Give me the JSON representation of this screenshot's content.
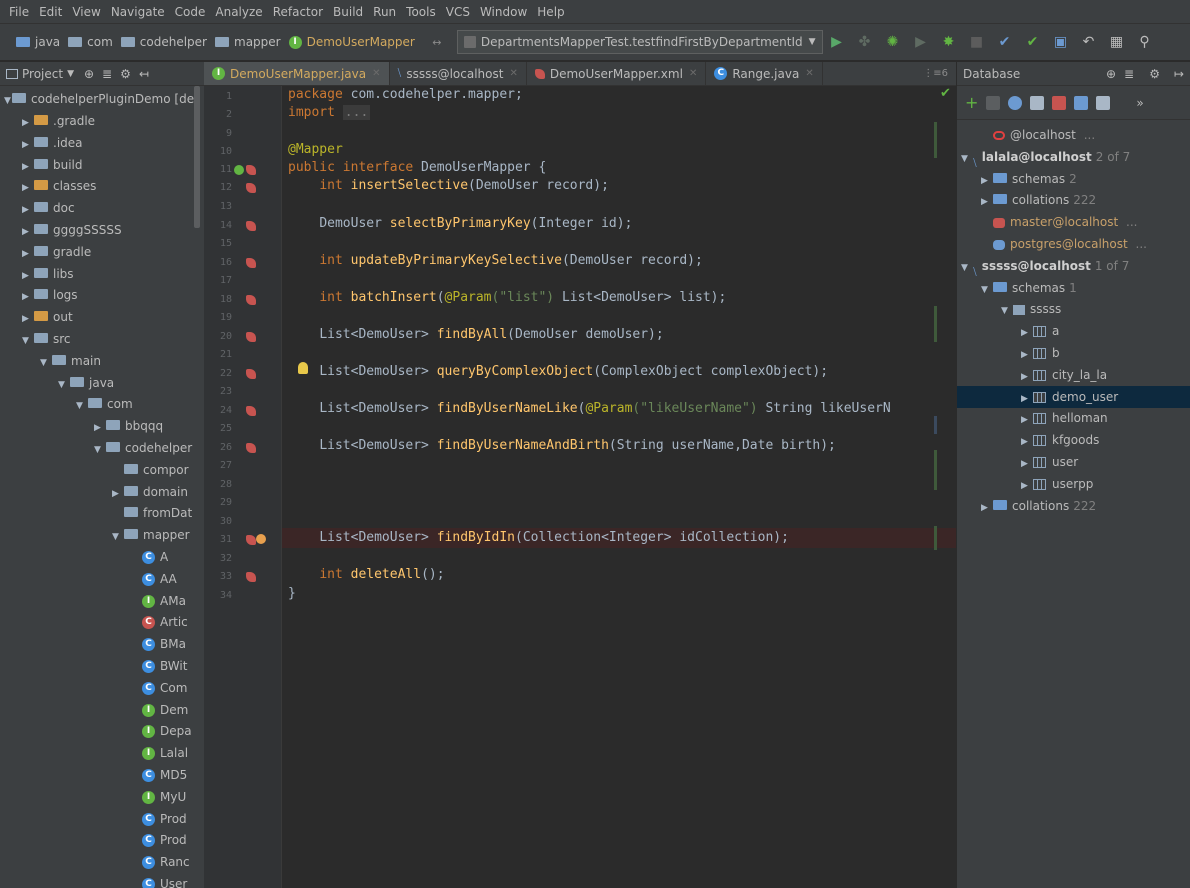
{
  "menu": [
    "File",
    "Edit",
    "View",
    "Navigate",
    "Code",
    "Analyze",
    "Refactor",
    "Build",
    "Run",
    "Tools",
    "VCS",
    "Window",
    "Help"
  ],
  "breadcrumbs": [
    "java",
    "com",
    "codehelper",
    "mapper",
    "DemoUserMapper"
  ],
  "run_config": "DepartmentsMapperTest.testfindFirstByDepartmentId",
  "project_panel": {
    "title": "Project",
    "root": "codehelperPluginDemo [der",
    "items": [
      {
        "label": ".gradle",
        "indent": 1
      },
      {
        "label": ".idea",
        "indent": 1
      },
      {
        "label": "build",
        "indent": 1
      },
      {
        "label": "classes",
        "indent": 1
      },
      {
        "label": "doc",
        "indent": 1
      },
      {
        "label": "ggggSSSSS",
        "indent": 1
      },
      {
        "label": "gradle",
        "indent": 1
      },
      {
        "label": "libs",
        "indent": 1
      },
      {
        "label": "logs",
        "indent": 1
      },
      {
        "label": "out",
        "indent": 1
      },
      {
        "label": "src",
        "indent": 1
      },
      {
        "label": "main",
        "indent": 2
      },
      {
        "label": "java",
        "indent": 3
      },
      {
        "label": "com",
        "indent": 4
      },
      {
        "label": "bbqqq",
        "indent": 5
      },
      {
        "label": "codehelper",
        "indent": 5
      },
      {
        "label": "compor",
        "indent": 6
      },
      {
        "label": "domain",
        "indent": 6
      },
      {
        "label": "fromDat",
        "indent": 6
      },
      {
        "label": "mapper",
        "indent": 6
      },
      {
        "label": "A",
        "indent": 7
      },
      {
        "label": "AA",
        "indent": 7
      },
      {
        "label": "AMa",
        "indent": 7
      },
      {
        "label": "Artic",
        "indent": 7
      },
      {
        "label": "BMa",
        "indent": 7
      },
      {
        "label": "BWit",
        "indent": 7
      },
      {
        "label": "Com",
        "indent": 7
      },
      {
        "label": "Dem",
        "indent": 7
      },
      {
        "label": "Depa",
        "indent": 7
      },
      {
        "label": "Lalal",
        "indent": 7
      },
      {
        "label": "MD5",
        "indent": 7
      },
      {
        "label": "MyU",
        "indent": 7
      },
      {
        "label": "Prod",
        "indent": 7
      },
      {
        "label": "Prod",
        "indent": 7
      },
      {
        "label": "Ranc",
        "indent": 7
      },
      {
        "label": "User",
        "indent": 7
      }
    ]
  },
  "tabs": [
    {
      "label": "DemoUserMapper.java",
      "active": true
    },
    {
      "label": "sssss@localhost",
      "active": false
    },
    {
      "label": "DemoUserMapper.xml",
      "active": false
    },
    {
      "label": "Range.java",
      "active": false
    }
  ],
  "tab_overflow": "⋮≡6",
  "line_numbers": [
    "1",
    "2",
    "9",
    "10",
    "11",
    "12",
    "13",
    "14",
    "15",
    "16",
    "17",
    "18",
    "19",
    "20",
    "21",
    "22",
    "23",
    "24",
    "25",
    "26",
    "27",
    "28",
    "29",
    "30",
    "31",
    "32",
    "33",
    "34"
  ],
  "code": {
    "package_kw": "package",
    "package_name": " com.codehelper.mapper;",
    "import_kw": "import",
    "import_fold": "...",
    "annotation": "@Mapper",
    "iface_kw": "public interface",
    "iface_name": " DemoUserMapper {",
    "insertSelective_t": "int ",
    "insertSelective_m": "insertSelective",
    "insertSelective_a": "(DemoUser record);",
    "selectByPrimaryKey_t": "DemoUser ",
    "selectByPrimaryKey_m": "selectByPrimaryKey",
    "selectByPrimaryKey_a": "(Integer id);",
    "updateByPrimaryKeySelective_t": "int ",
    "updateByPrimaryKeySelective_m": "updateByPrimaryKeySelective",
    "updateByPrimaryKeySelective_a": "(DemoUser record);",
    "batchInsert_t": "int ",
    "batchInsert_m": "batchInsert",
    "batchInsert_p": "(",
    "batchInsert_an": "@Param",
    "batchInsert_s": "(\"list\")",
    "batchInsert_a": " List<DemoUser> list);",
    "findByAll_t": "List<DemoUser> ",
    "findByAll_m": "findByAll",
    "findByAll_a": "(DemoUser demoUser);",
    "queryByComplexObject_t": "List<DemoUser> ",
    "queryByComplexObject_m": "queryByComplexObject",
    "queryByComplexObject_a": "(ComplexObject complexObject);",
    "findByUserNameLike_t": "List<DemoUser> ",
    "findByUserNameLike_m": "findByUserNameLike",
    "findByUserNameLike_p": "(",
    "findByUserNameLike_an": "@Param",
    "findByUserNameLike_s": "(\"likeUserName\")",
    "findByUserNameLike_a": " String likeUserN",
    "findByUserNameAndBirth_t": "List<DemoUser> ",
    "findByUserNameAndBirth_m": "findByUserNameAndBirth",
    "findByUserNameAndBirth_a": "(String userName,Date birth);",
    "findByIdIn_t": "List<DemoUser> ",
    "findByIdIn_m": "findByIdIn",
    "findByIdIn_a": "(Collection<Integer> idCollection);",
    "deleteAll_t": "int ",
    "deleteAll_m": "deleteAll",
    "deleteAll_a": "();",
    "close": "}"
  },
  "database": {
    "title": "Database",
    "items": [
      {
        "label": "@localhost",
        "extra": " ...",
        "indent": 1,
        "arrow": "",
        "icon": "oracle"
      },
      {
        "label": "lalala@localhost",
        "extra": "2 of 7",
        "indent": 0,
        "arrow": "▼",
        "icon": "ds",
        "bold": true
      },
      {
        "label": "schemas",
        "extra": "2",
        "indent": 1,
        "arrow": "▶",
        "icon": "folder"
      },
      {
        "label": "collations",
        "extra": "222",
        "indent": 1,
        "arrow": "▶",
        "icon": "folder"
      },
      {
        "label": "master@localhost",
        "extra": " ...",
        "indent": 1,
        "arrow": "",
        "icon": "mssql"
      },
      {
        "label": "postgres@localhost",
        "extra": " ...",
        "indent": 1,
        "arrow": "",
        "icon": "pg"
      },
      {
        "label": "sssss@localhost",
        "extra": "1 of 7",
        "indent": 0,
        "arrow": "▼",
        "icon": "ds",
        "bold": true
      },
      {
        "label": "schemas",
        "extra": "1",
        "indent": 1,
        "arrow": "▼",
        "icon": "folder"
      },
      {
        "label": "sssss",
        "extra": "",
        "indent": 2,
        "arrow": "▼",
        "icon": "schema"
      },
      {
        "label": "a",
        "extra": "",
        "indent": 3,
        "arrow": "▶",
        "icon": "table"
      },
      {
        "label": "b",
        "extra": "",
        "indent": 3,
        "arrow": "▶",
        "icon": "table"
      },
      {
        "label": "city_la_la",
        "extra": "",
        "indent": 3,
        "arrow": "▶",
        "icon": "table"
      },
      {
        "label": "demo_user",
        "extra": "",
        "indent": 3,
        "arrow": "▶",
        "icon": "table",
        "selected": true
      },
      {
        "label": "helloman",
        "extra": "",
        "indent": 3,
        "arrow": "▶",
        "icon": "table"
      },
      {
        "label": "kfgoods",
        "extra": "",
        "indent": 3,
        "arrow": "▶",
        "icon": "table"
      },
      {
        "label": "user",
        "extra": "",
        "indent": 3,
        "arrow": "▶",
        "icon": "table"
      },
      {
        "label": "userpp",
        "extra": "",
        "indent": 3,
        "arrow": "▶",
        "icon": "table"
      },
      {
        "label": "collations",
        "extra": "222",
        "indent": 1,
        "arrow": "▶",
        "icon": "folder"
      }
    ]
  }
}
